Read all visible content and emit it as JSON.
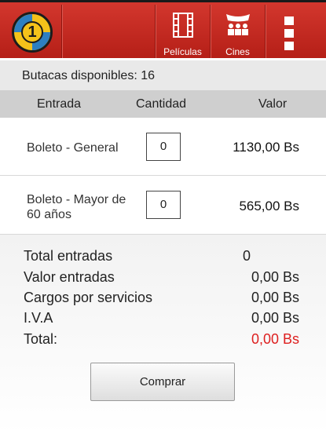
{
  "nav": {
    "movies_label": "Películas",
    "cinemas_label": "Cines",
    "logo_text": "1"
  },
  "availability": "Butacas disponibles: 16",
  "table": {
    "headers": [
      "Entrada",
      "Cantidad",
      "Valor"
    ],
    "rows": [
      {
        "name": "Boleto - General",
        "qty": "0",
        "price": "1130,00 Bs"
      },
      {
        "name": "Boleto - Mayor de 60 años",
        "qty": "0",
        "price": "565,00 Bs"
      }
    ]
  },
  "summary": {
    "total_tickets_label": "Total entradas",
    "total_tickets_value": "0",
    "tickets_value_label": "Valor entradas",
    "tickets_value": "0,00 Bs",
    "service_charges_label": "Cargos por servicios",
    "service_charges_value": "0,00 Bs",
    "vat_label": "I.V.A",
    "vat_value": "0,00 Bs",
    "total_label": "Total:",
    "total_value": "0,00 Bs"
  },
  "buy_label": "Comprar",
  "colors": {
    "header_red": "#c62a22",
    "total_red": "#dd1f1f"
  }
}
